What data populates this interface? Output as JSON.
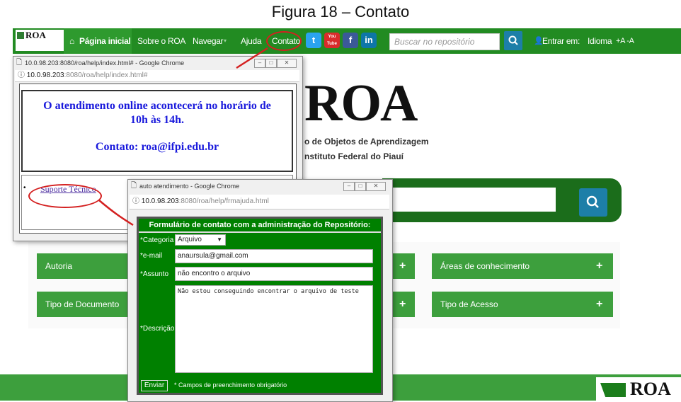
{
  "caption": "Figura 18 – Contato",
  "nav": {
    "logo_text": "ROA",
    "items": [
      "Página inicial",
      "Sobre o ROA",
      "Navegar",
      "Ajuda",
      "Contato"
    ],
    "social": [
      "t",
      "You Tube",
      "f",
      "in"
    ],
    "search_placeholder": "Buscar no repositório",
    "login": "Entrar em:",
    "language": "Idioma",
    "font_size": "+A -A"
  },
  "page": {
    "logo_big": "ROA",
    "subtitle1": "o de Objetos de Aprendizagem",
    "subtitle2": "nstituto Federal do Piauí",
    "buttons": [
      "Autoria",
      "Áreas de conhecimento",
      "Tipo de Documento",
      "Tipo de Acesso"
    ],
    "footer_logo": "ROA"
  },
  "window1": {
    "title": "10.0.98.203:8080/roa/help/index.html# - Google Chrome",
    "url_host": "10.0.98.203",
    "url_path": ":8080/roa/help/index.html#",
    "message_line1": "O atendimento online acontecerá no horário de",
    "message_line2": "10h às 14h.",
    "contact": "Contato: roa@ifpi.edu.br",
    "link": "Suporte Técnico"
  },
  "window2": {
    "title": "auto atendimento - Google Chrome",
    "url_host": "10.0.98.203",
    "url_path": ":8080/roa/help/frmajuda.html",
    "form_title": "Formulário de contato com a administração do Repositório:",
    "category_label": "*Categoria",
    "category_value": "Arquivo",
    "email_label": "*e-mail",
    "email_value": "anaursula@gmail.com",
    "subject_label": "*Assunto",
    "subject_value": "não encontro o arquivo",
    "desc_label": "*Descrição",
    "desc_value": "Não estou conseguindo encontrar o arquivo de teste",
    "submit": "Enviar",
    "note": "* Campos de preenchimento obrigatório"
  }
}
